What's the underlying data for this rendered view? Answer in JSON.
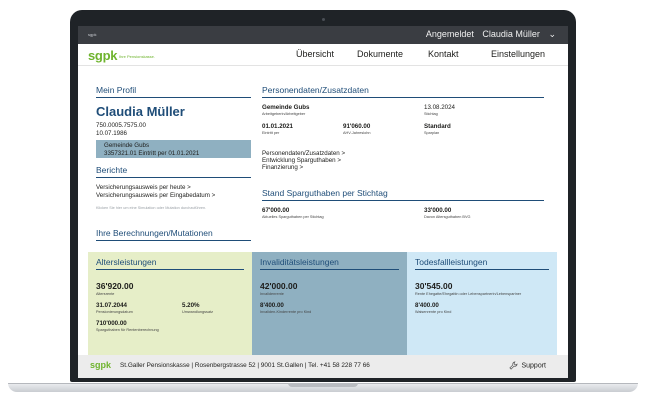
{
  "topbar": {
    "tiny_label": "sgpk",
    "login_label": "Angemeldet",
    "user_name": "Claudia Müller",
    "user_chevron": "⌄"
  },
  "header": {
    "logo": "sgpk",
    "logo_tagline": "Ihre Pensionskasse.",
    "nav": [
      "Übersicht",
      "Dokumente",
      "Kontakt",
      "Einstellungen"
    ]
  },
  "profile": {
    "heading": "Mein Profil",
    "name": "Claudia Müller",
    "ahv_number": "750.0005.7575.00",
    "birth_date": "10.07.1986",
    "employer_name": "Gemeinde Gubs",
    "employer_detail": "3357321.01   Eintritt per 01.01.2021"
  },
  "reports": {
    "heading": "Berichte",
    "links": [
      "Versicherungsausweis per heute >",
      "Versicherungsausweis per Eingabedatum >"
    ],
    "hint": "Klicken Sie hier um eine Simulation oder Mutation durchzuführen."
  },
  "calculations": {
    "heading": "Ihre Berechnungen/Mutationen"
  },
  "personal": {
    "heading": "Personendaten/Zusatzdaten",
    "employer_value": "Gemeinde Gubs",
    "employer_label": "Arbeitgeberin/Arbeitgeber",
    "date_value": "13.08.2024",
    "date_label": "Stichtag",
    "entry_value": "01.01.2021",
    "entry_label": "Eintritt per",
    "salary_value": "91'060.00",
    "salary_label": "AHV-Jahreslohn",
    "plan_value": "Standard",
    "plan_label": "Sparplan",
    "links": [
      "Personendaten/Zusatzdaten >",
      "Entwicklung Sparguthaben >",
      "Finanzierung >"
    ]
  },
  "savings": {
    "heading": "Stand Sparguthaben per Stichtag",
    "current_value": "67'000.00",
    "current_label": "Aktuelles Sparguthaben per Stichtag",
    "bvg_value": "33'000.00",
    "bvg_label": "Davon Altersguthaben BVG"
  },
  "panels": {
    "retirement": {
      "title": "Altersleistungen",
      "pension_value": "36'920.00",
      "pension_label": "Altersrente",
      "date_value": "31.07.2044",
      "date_label": "Pensionierungsdatum",
      "rate_value": "5.20%",
      "rate_label": "Umwandlungssatz",
      "capital_value": "710'000.00",
      "capital_label": "Sparguthaben für Rentenberechnung"
    },
    "disability": {
      "title": "Invaliditätsleistungen",
      "pension_value": "42'000.00",
      "pension_label": "Invalidenrente",
      "child_value": "8'400.00",
      "child_label": "Invaliden-Kinderrente pro Kind"
    },
    "death": {
      "title": "Todesfallleistungen",
      "partner_value": "30'545.00",
      "partner_label": "Rente Ehegatte/Ehegattin oder Lebenspartnerin/Lebenspartner",
      "orphan_value": "8'400.00",
      "orphan_label": "Waisenrente pro Kind"
    }
  },
  "footer": {
    "logo": "sgpk",
    "address": "St.Galler Pensionskasse | Rosenbergstrasse 52 | 9001 St.Gallen | Tel. +41 58 228 77 66",
    "support_label": "Support",
    "support_icon": "wrench-icon"
  },
  "colors": {
    "brand_green": "#6fb42e",
    "heading_blue": "#1f4d78",
    "panel_green": "#e6eec8",
    "panel_teal": "#8fb0c1",
    "panel_blue": "#cfe8f6"
  }
}
